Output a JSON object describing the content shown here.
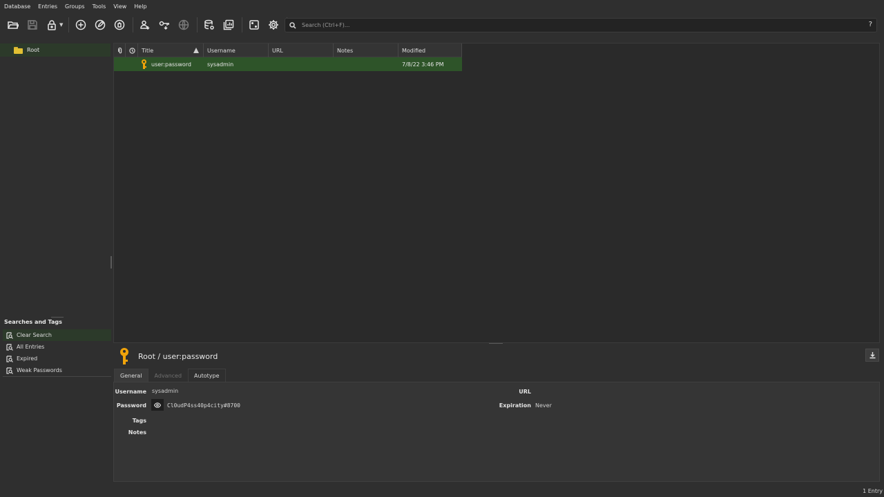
{
  "menu": [
    "Database",
    "Entries",
    "Groups",
    "Tools",
    "View",
    "Help"
  ],
  "toolbar": {
    "buttons": [
      {
        "name": "open-database-icon"
      },
      {
        "name": "save-database-icon"
      },
      {
        "name": "lock-database-icon"
      },
      {
        "name": "add-entry-icon"
      },
      {
        "name": "edit-entry-icon"
      },
      {
        "name": "delete-entry-icon"
      },
      {
        "name": "copy-username-icon"
      },
      {
        "name": "copy-password-icon"
      },
      {
        "name": "copy-url-icon"
      },
      {
        "name": "database-settings-icon"
      },
      {
        "name": "reports-icon"
      },
      {
        "name": "password-generator-icon"
      },
      {
        "name": "settings-icon"
      }
    ]
  },
  "search": {
    "placeholder": "Search (Ctrl+F)...",
    "help": "?"
  },
  "tree": {
    "root": "Root"
  },
  "searches_title": "Searches and Tags",
  "searches": [
    "Clear Search",
    "All Entries",
    "Expired",
    "Weak Passwords"
  ],
  "table": {
    "columns": [
      "Title",
      "Username",
      "URL",
      "Notes",
      "Modified"
    ],
    "rows": [
      {
        "title": "user:password",
        "username": "sysadmin",
        "url": "",
        "notes": "",
        "modified": "7/8/22 3:46 PM"
      }
    ]
  },
  "detail": {
    "path": "Root / user:password",
    "tabs": [
      "General",
      "Advanced",
      "Autotype"
    ],
    "labels": {
      "username": "Username",
      "password": "Password",
      "tags": "Tags",
      "notes": "Notes",
      "url": "URL",
      "expiration": "Expiration"
    },
    "values": {
      "username": "sysadmin",
      "password": "Cl0udP4ss40p4city#8700",
      "expiration": "Never"
    }
  },
  "status": "1 Entry",
  "colors": {
    "selection": "#2e5429",
    "key": "#f0a30a",
    "folder": "#e3c033"
  }
}
